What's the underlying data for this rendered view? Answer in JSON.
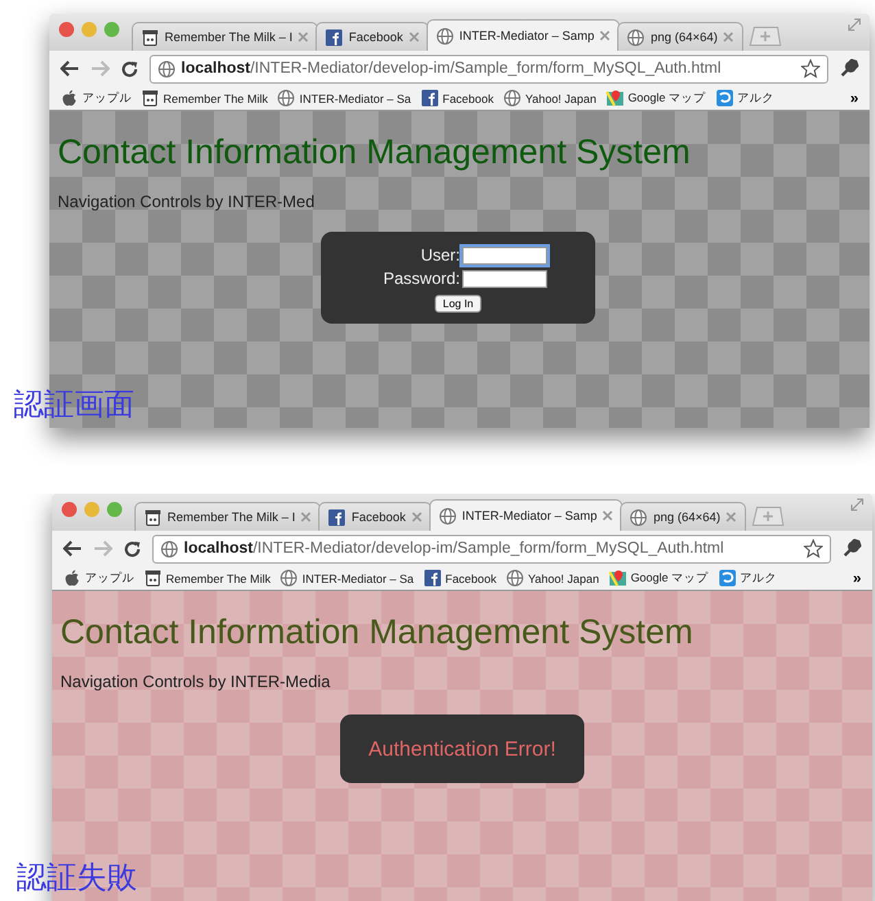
{
  "panels": [
    {
      "caption": "認証画面",
      "browser": {
        "tabs": [
          {
            "label": "Remember The Milk – I",
            "kind": "jar",
            "selected": false
          },
          {
            "label": "Facebook",
            "kind": "facebook",
            "selected": false
          },
          {
            "label": "INTER-Mediator – Samp",
            "kind": "globe",
            "selected": true
          },
          {
            "label": "png (64×64)",
            "kind": "globe",
            "selected": false
          }
        ],
        "url": {
          "host": "localhost",
          "path": "/INTER-Mediator/develop-im/Sample_form/form_MySQL_Auth.html"
        },
        "bookmarks": [
          {
            "label": "アップル",
            "kind": "apple"
          },
          {
            "label": "Remember The Milk",
            "kind": "jar"
          },
          {
            "label": "INTER-Mediator – Sa",
            "kind": "globe"
          },
          {
            "label": "Facebook",
            "kind": "facebook"
          },
          {
            "label": "Yahoo! Japan",
            "kind": "globe"
          },
          {
            "label": "Google マップ",
            "kind": "maps"
          },
          {
            "label": "アルク",
            "kind": "swirl"
          }
        ],
        "more": "»"
      },
      "page": {
        "heading": "Contact Information Management System",
        "nav_text": "Navigation Controls by INTER-Med",
        "dialog": {
          "kind": "login",
          "fields": [
            {
              "label": "User:",
              "focused": true
            },
            {
              "label": "Password:",
              "focused": false
            }
          ],
          "button": "Log In"
        }
      }
    },
    {
      "caption": "認証失敗",
      "browser": {
        "tabs": [
          {
            "label": "Remember The Milk – I",
            "kind": "jar",
            "selected": false
          },
          {
            "label": "Facebook",
            "kind": "facebook",
            "selected": false
          },
          {
            "label": "INTER-Mediator – Samp",
            "kind": "globe",
            "selected": true
          },
          {
            "label": "png (64×64)",
            "kind": "globe",
            "selected": false
          }
        ],
        "url": {
          "host": "localhost",
          "path": "/INTER-Mediator/develop-im/Sample_form/form_MySQL_Auth.html"
        },
        "bookmarks": [
          {
            "label": "アップル",
            "kind": "apple"
          },
          {
            "label": "Remember The Milk",
            "kind": "jar"
          },
          {
            "label": "INTER-Mediator – Sa",
            "kind": "globe"
          },
          {
            "label": "Facebook",
            "kind": "facebook"
          },
          {
            "label": "Yahoo! Japan",
            "kind": "globe"
          },
          {
            "label": "Google マップ",
            "kind": "maps"
          },
          {
            "label": "アルク",
            "kind": "swirl"
          }
        ],
        "more": "»"
      },
      "page": {
        "heading": "Contact Information Management System",
        "nav_text": "Navigation Controls by INTER-Media",
        "dialog": {
          "kind": "error",
          "message": "Authentication Error!"
        }
      }
    }
  ]
}
